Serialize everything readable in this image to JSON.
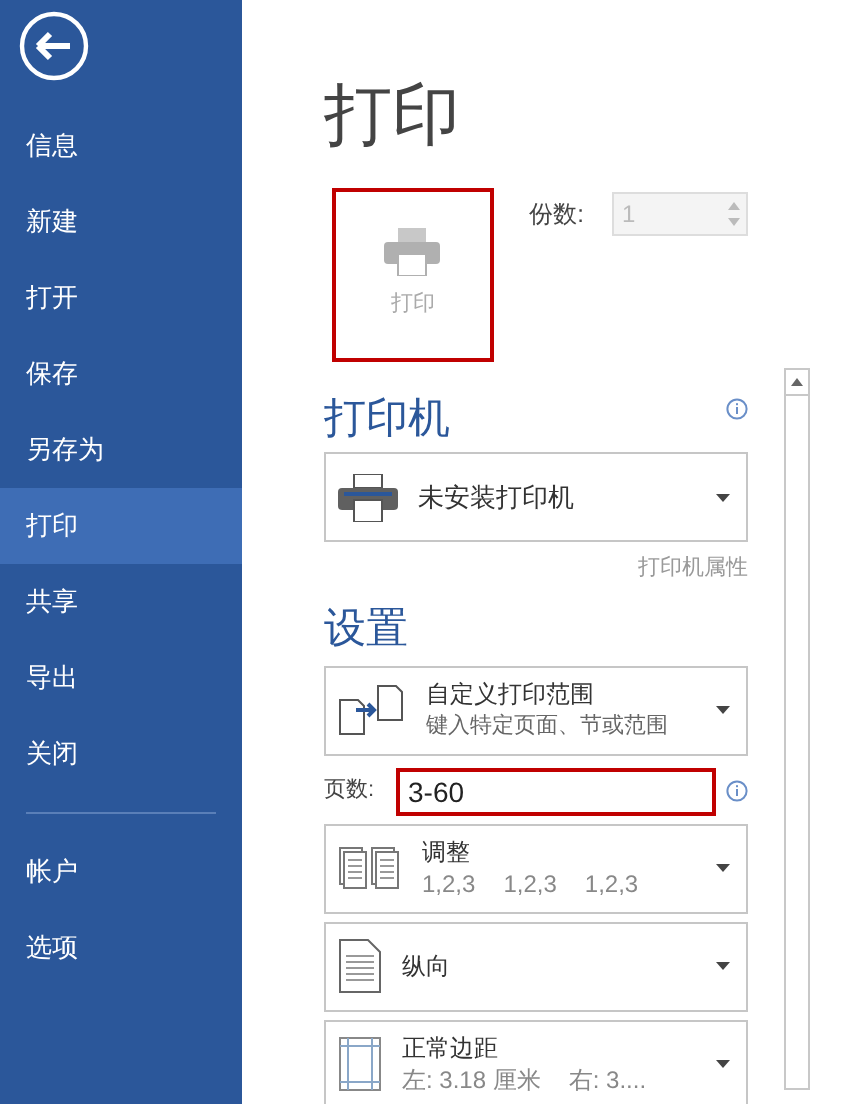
{
  "sidebar": {
    "items": [
      {
        "label": "信息",
        "selected": false
      },
      {
        "label": "新建",
        "selected": false
      },
      {
        "label": "打开",
        "selected": false
      },
      {
        "label": "保存",
        "selected": false
      },
      {
        "label": "另存为",
        "selected": false
      },
      {
        "label": "打印",
        "selected": true
      },
      {
        "label": "共享",
        "selected": false
      },
      {
        "label": "导出",
        "selected": false
      },
      {
        "label": "关闭",
        "selected": false
      }
    ],
    "bottom_items": [
      {
        "label": "帐户",
        "selected": false
      },
      {
        "label": "选项",
        "selected": false
      }
    ]
  },
  "heading": "打印",
  "print_button": {
    "label": "打印",
    "disabled": true
  },
  "copies": {
    "label": "份数:",
    "value": "1",
    "disabled": true
  },
  "printer": {
    "heading": "打印机",
    "selected": "未安装打印机",
    "properties_link": "打印机属性"
  },
  "settings": {
    "heading": "设置",
    "options": [
      {
        "kind": "range",
        "title": "自定义打印范围",
        "subtitle": "键入特定页面、节或范围"
      },
      {
        "kind": "pages",
        "label": "页数:",
        "value": "3-60"
      },
      {
        "kind": "collate",
        "title": "调整",
        "subtitle_parts": [
          "1,2,3",
          "1,2,3",
          "1,2,3"
        ]
      },
      {
        "kind": "orientation",
        "title": "纵向"
      },
      {
        "kind": "margins",
        "title": "正常边距",
        "subtitle_parts": [
          "左: 3.18 厘米",
          "右: 3...."
        ]
      }
    ]
  }
}
